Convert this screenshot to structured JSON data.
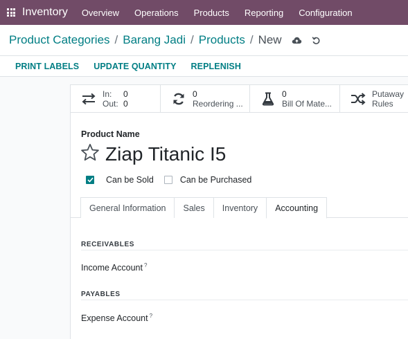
{
  "navbar": {
    "brand": "Inventory",
    "items": [
      "Overview",
      "Operations",
      "Products",
      "Reporting",
      "Configuration"
    ]
  },
  "breadcrumb": {
    "items": [
      "Product Categories",
      "Barang Jadi",
      "Products"
    ],
    "current": "New"
  },
  "actions": {
    "print_labels": "PRINT LABELS",
    "update_quantity": "UPDATE QUANTITY",
    "replenish": "REPLENISH"
  },
  "smart_buttons": {
    "inout": {
      "in_label": "In:",
      "in_value": "0",
      "out_label": "Out:",
      "out_value": "0"
    },
    "reordering": {
      "value": "0",
      "label": "Reordering ..."
    },
    "bom": {
      "value": "0",
      "label": "Bill Of Mate..."
    },
    "putaway": {
      "line1": "Putaway",
      "line2": "Rules"
    }
  },
  "form": {
    "product_name_label": "Product Name",
    "product_name": "Ziap Titanic I5",
    "can_be_sold": {
      "label": "Can be Sold",
      "checked": true
    },
    "can_be_purchased": {
      "label": "Can be Purchased",
      "checked": false
    }
  },
  "tabs": [
    "General Information",
    "Sales",
    "Inventory",
    "Accounting"
  ],
  "active_tab": "Accounting",
  "accounting": {
    "receivables_title": "RECEIVABLES",
    "income_account_label": "Income Account",
    "income_account_help": "?",
    "payables_title": "PAYABLES",
    "expense_account_label": "Expense Account",
    "expense_account_help": "?"
  },
  "colors": {
    "navbar": "#714b67",
    "accent": "#017e84"
  }
}
